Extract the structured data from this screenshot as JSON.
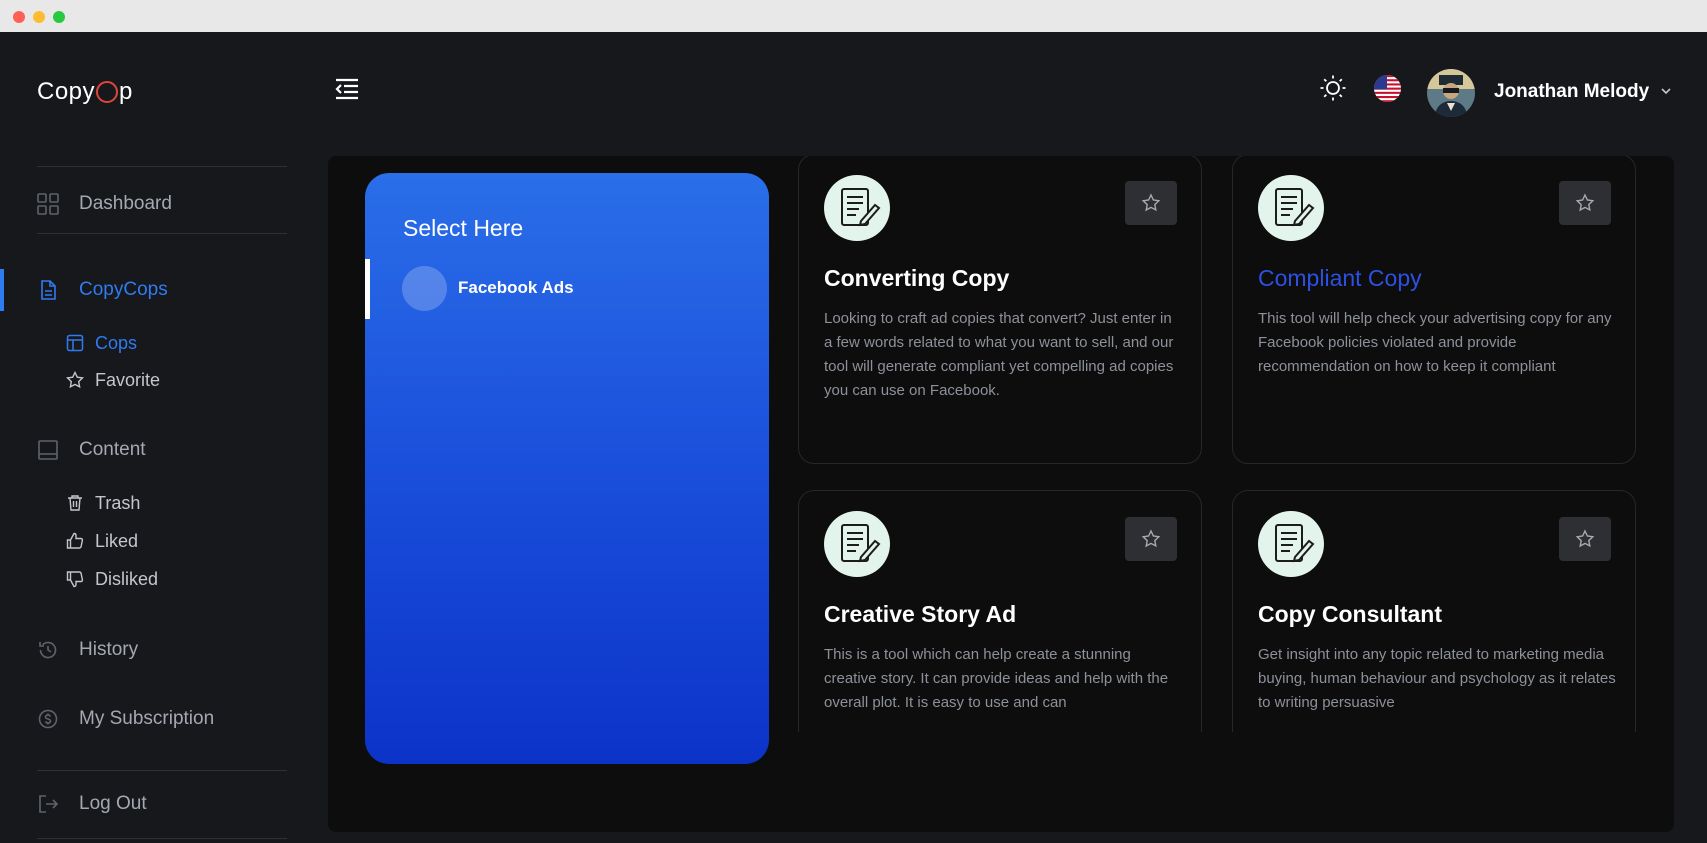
{
  "app": {
    "logo_text_left": "Copy",
    "logo_text_right": "p"
  },
  "sidebar": {
    "dashboard": "Dashboard",
    "copycops": "CopyCops",
    "cops": "Cops",
    "favorite": "Favorite",
    "content": "Content",
    "trash": "Trash",
    "liked": "Liked",
    "disliked": "Disliked",
    "history": "History",
    "subscription": "My Subscription",
    "logout": "Log Out"
  },
  "header": {
    "username": "Jonathan Melody"
  },
  "selector": {
    "title": "Select Here",
    "items": [
      {
        "label": "Facebook Ads",
        "selected": true
      }
    ]
  },
  "tools": [
    {
      "title": "Converting Copy",
      "description": "Looking to craft ad copies that convert? Just enter in a few words related to what you want to sell, and our tool will generate compliant yet compelling ad copies you can use on Facebook."
    },
    {
      "title": "Compliant Copy",
      "description": "This tool will help check your advertising copy for any Facebook policies violated and provide recommendation on how to keep it compliant"
    },
    {
      "title": "Creative Story Ad",
      "description": "This is a tool which can help create a stunning creative story. It can provide ideas and help with the overall plot. It is easy to use and can"
    },
    {
      "title": "Copy Consultant",
      "description": "Get insight into any topic related to marketing media buying, human behaviour and psychology as it relates to writing persuasive"
    }
  ],
  "colors": {
    "accent": "#2f7bf0",
    "background": "#17181c",
    "panel": "#0d0d0d",
    "selector_gradient_top": "#2a6ee8",
    "selector_gradient_bottom": "#0c33c8"
  },
  "icons": {
    "menu_toggle": "menu-collapse-icon",
    "theme": "sun-icon",
    "language": "us-flag-icon",
    "tool": "document-pencil-icon",
    "favorite": "star-icon"
  }
}
